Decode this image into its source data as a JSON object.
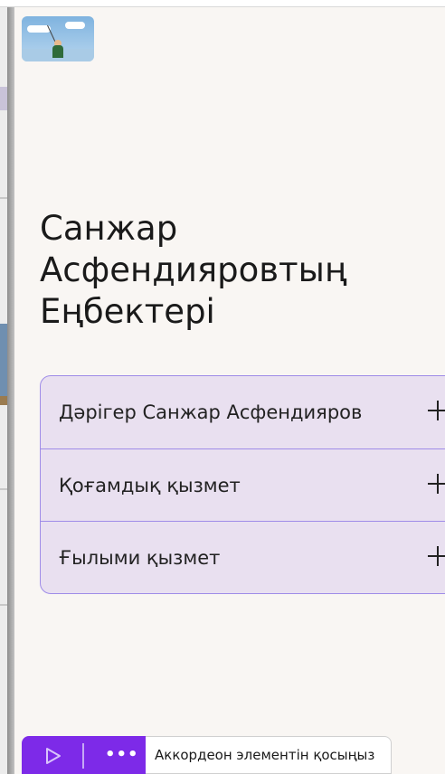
{
  "title": {
    "line1": "Санжар",
    "line2": "Асфендияровтың",
    "line3": "Еңбектері"
  },
  "accordion": {
    "items": [
      {
        "label": "Дәрігер Санжар Асфендияров",
        "icon": "plus-icon"
      },
      {
        "label": "Қоғамдық қызмет",
        "icon": "plus-icon"
      },
      {
        "label": "Ғылыми қызмет",
        "icon": "plus-icon"
      }
    ]
  },
  "toolbar": {
    "play_icon": "play-icon",
    "more_label": "•••",
    "add_label": "Аккордеон элементін қосыңыз"
  },
  "colors": {
    "accent": "#7d2ae8",
    "accordion_bg": "#e9e0f0",
    "accordion_border": "#9f8ce8",
    "panel_bg": "#f9f6f3"
  }
}
